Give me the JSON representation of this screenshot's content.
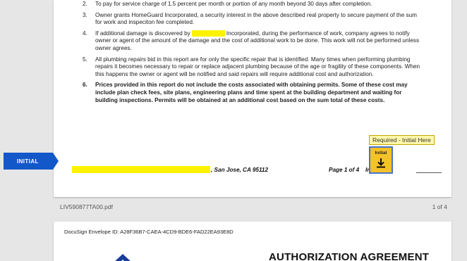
{
  "terms": [
    {
      "num": "2.",
      "text": "To pay for service charge of 1.5 percent per month or portion of any month beyond 30 days after completion.",
      "bold": false
    },
    {
      "num": "3.",
      "text": "Owner grants HomeGuard Incorporated, a security interest in the above described real property to secure payment of the sum for work and inspeciton fee completed.",
      "bold": false
    },
    {
      "num": "4.",
      "text_before": "If additional damage is discovered by",
      "text_after": "Incorporated, during the performance of work, company agrees to notify owner or agent of the amount of the damage and the cost of additional work to be done.  This work will not be performed unless owner agrees.",
      "bold": false
    },
    {
      "num": "5.",
      "text": "All plumbing repairs bid in this report are for only the specific repair that is identified.  Many times when performing plumbing repairs it becomes necessary to repair or replace adjacent plumbing because of the age or fragility of these components.  When this happens the owner or agent will be notified and said repairs will require additional cost and authorization.",
      "bold": false
    },
    {
      "num": "6.",
      "text": "Prices provided in this report do not include the costs associated with obtaining  permits. Some of these cost may include plan check fees, site plans, engineering plans and time spent at the building department and waiting for building inspections. Permits will be obtained at an additional cost based on the sum total of these costs.",
      "bold": true
    }
  ],
  "footer": {
    "address": ", San Jose, CA 95112",
    "page": "Page 1 of 4",
    "initials": "Initials"
  },
  "initial_tab": {
    "label": "INITIAL"
  },
  "tooltip": {
    "text": "Required - Initial Here"
  },
  "initial_field": {
    "label": "Initial"
  },
  "document": {
    "filename": "LIV590877TA00.pdf",
    "pages": "1 of 4"
  },
  "page2": {
    "envelope_id": "DocuSign Envelope ID: A28F36B7-CAEA-4CD9-BDE6-FAD22EA93E8D",
    "title": "AUTHORIZATION AGREEMENT"
  },
  "colors": {
    "accent": "#1358c8",
    "field": "#f7c227",
    "highlight": "#fff200"
  }
}
